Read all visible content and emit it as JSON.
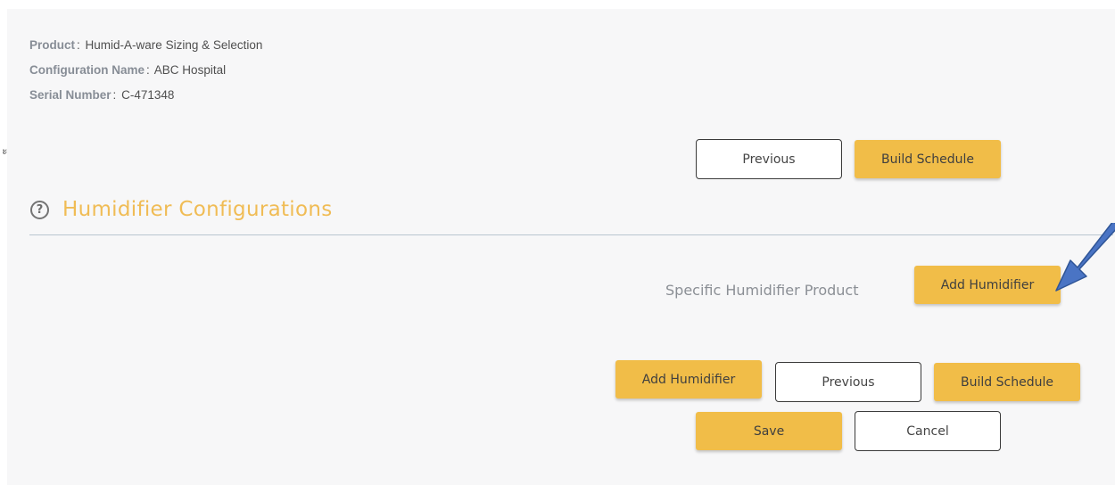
{
  "info": {
    "product_label": "Product",
    "product_value": "Humid-A-ware Sizing & Selection",
    "config_label": "Configuration Name",
    "config_value": "ABC Hospital",
    "serial_label": "Serial Number",
    "serial_value": "C-471348",
    "separator": ":"
  },
  "top_nav": {
    "previous_label": "Previous",
    "build_label": "Build Schedule"
  },
  "section": {
    "icon": "help-circle-icon",
    "title": "Humidifier Configurations"
  },
  "specific": {
    "label": "Specific Humidifier Product",
    "add_label": "Add Humidifier"
  },
  "bottom_nav": {
    "add_label": "Add Humidifier",
    "previous_label": "Previous",
    "build_label": "Build Schedule",
    "save_label": "Save",
    "cancel_label": "Cancel"
  },
  "colors": {
    "accent": "#f1bd48",
    "title": "#f0bc55",
    "arrow": "#4a74c4"
  }
}
